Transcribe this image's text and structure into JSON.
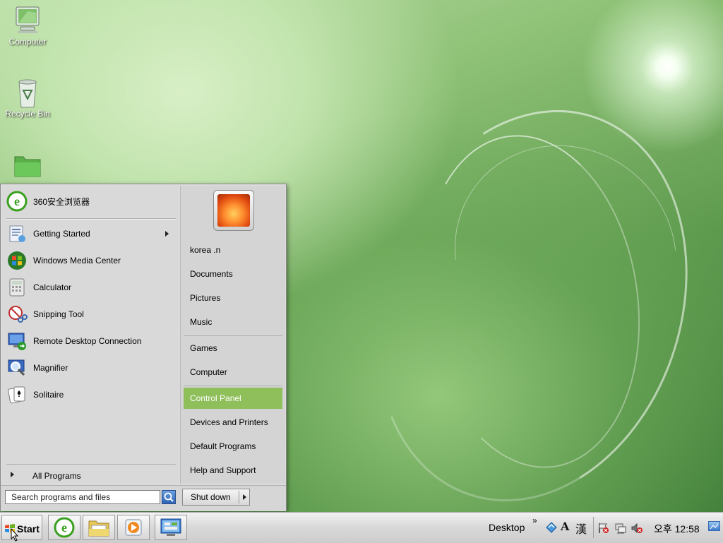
{
  "desktop": {
    "icons": [
      {
        "label": "Computer",
        "icon": "computer-icon"
      },
      {
        "label": "Recycle Bin",
        "icon": "recycle-bin-icon"
      },
      {
        "label": "",
        "icon": "folder-icon"
      }
    ]
  },
  "start_menu": {
    "pinned": {
      "label": "360安全浏览器",
      "icon": "browser-360-icon"
    },
    "programs": [
      {
        "label": "Getting Started",
        "icon": "getting-started-icon",
        "has_submenu": true
      },
      {
        "label": "Windows Media Center",
        "icon": "media-center-icon"
      },
      {
        "label": "Calculator",
        "icon": "calculator-icon"
      },
      {
        "label": "Snipping Tool",
        "icon": "scissors-icon"
      },
      {
        "label": "Remote Desktop Connection",
        "icon": "remote-desktop-icon"
      },
      {
        "label": "Magnifier",
        "icon": "magnifier-icon"
      },
      {
        "label": "Solitaire",
        "icon": "cards-icon"
      }
    ],
    "all_programs": "All Programs",
    "search_placeholder": "Search programs and files",
    "user_name": "korea .n",
    "places": [
      "Documents",
      "Pictures",
      "Music"
    ],
    "places2": [
      "Games",
      "Computer"
    ],
    "places3": [
      "Control Panel",
      "Devices and Printers",
      "Default Programs",
      "Help and Support"
    ],
    "active_place": "Control Panel",
    "shutdown_label": "Shut down"
  },
  "taskbar": {
    "start_label": "Start",
    "pinned": [
      "browser-360-icon",
      "file-explorer-icon",
      "media-player-icon",
      "control-panel-icon"
    ],
    "desktop_toolbar": "Desktop",
    "chevron": "»",
    "ime_a": "A",
    "ime_han": "漢",
    "clock": "오후 12:58"
  },
  "colors": {
    "highlight": "#8fbf5a",
    "wallpaper": "#6aa85a"
  }
}
